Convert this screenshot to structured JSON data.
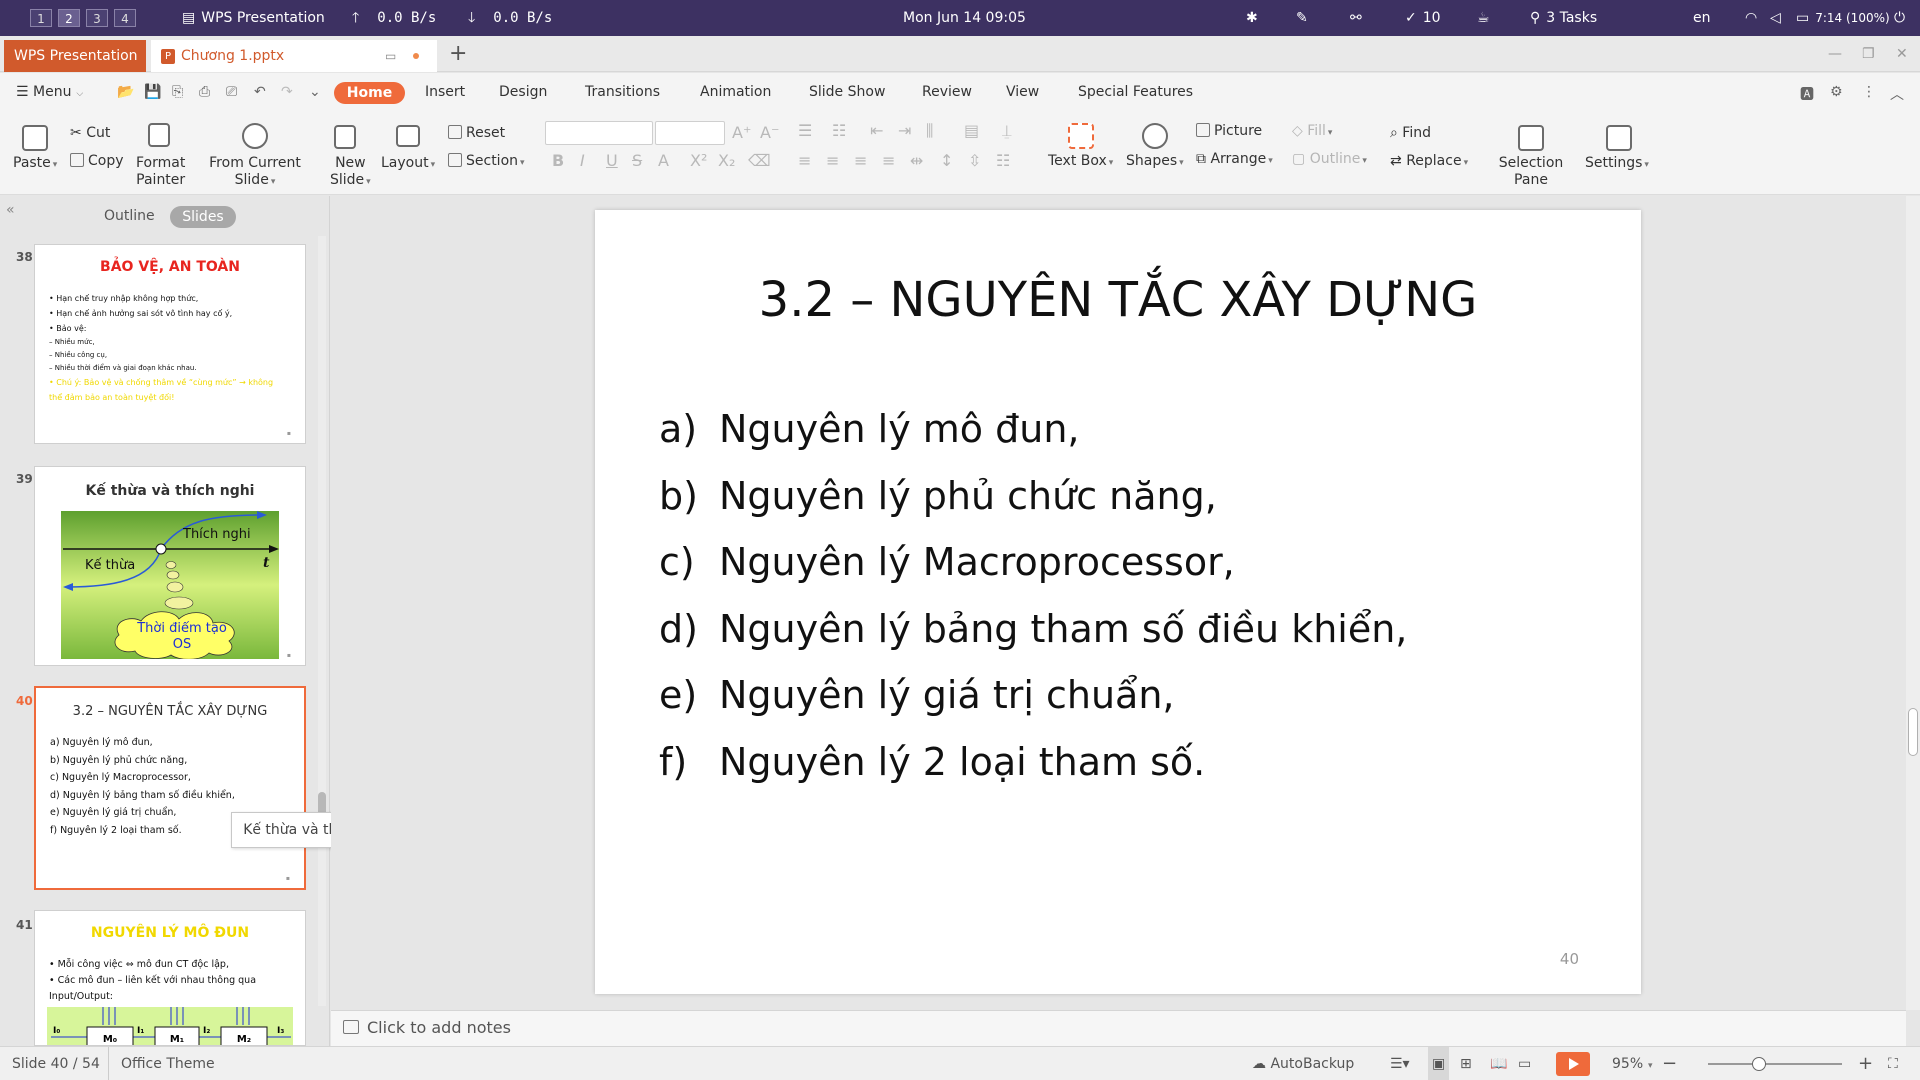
{
  "system_bar": {
    "workspaces": [
      "1",
      "2",
      "3",
      "4"
    ],
    "active_app": "WPS Presentation",
    "net_up": "0.0  B/s",
    "net_down": "0.0  B/s",
    "clock": "Mon Jun 14  09:05",
    "updates": "10",
    "tasks": "3 Tasks",
    "language": "en",
    "battery": "7:14 (100%)"
  },
  "tabs": {
    "app": "WPS Presentation",
    "doc": "Chương 1.pptx",
    "add_icon": "plus-icon"
  },
  "menu": {
    "menu_label": "Menu",
    "tabs": [
      "Home",
      "Insert",
      "Design",
      "Transitions",
      "Animation",
      "Slide Show",
      "Review",
      "View",
      "Special Features"
    ]
  },
  "ribbon": {
    "paste": "Paste",
    "cut": "Cut",
    "copy": "Copy",
    "format_painter_1": "Format",
    "format_painter_2": "Painter",
    "from_current_1": "From Current",
    "from_current_2": "Slide",
    "new_slide_1": "New",
    "new_slide_2": "Slide",
    "layout": "Layout",
    "reset": "Reset",
    "section": "Section",
    "text_box": "Text Box",
    "shapes": "Shapes",
    "picture": "Picture",
    "arrange": "Arrange",
    "fill": "Fill",
    "outline": "Outline",
    "find": "Find",
    "replace": "Replace",
    "selection_pane_1": "Selection",
    "selection_pane_2": "Pane",
    "settings": "Settings"
  },
  "left_panel": {
    "tab_outline": "Outline",
    "tab_slides": "Slides",
    "thumbnails": [
      {
        "number": "38",
        "title": "BẢO VỆ, AN TOÀN",
        "title_color": "#e8251f",
        "lines": [
          "•  Hạn chế truy nhập không hợp thức,",
          "•  Hạn chế ảnh hưởng sai sót vô tình hay cố ý,",
          "•  Bảo vệ:",
          "     –  Nhiều mức,",
          "     –  Nhiều công cụ,",
          "     –  Nhiều thời điểm và giai đoạn khác nhau.",
          "•  Chú ý: Bảo vệ và chống thâm về “cùng mức” → không",
          "    thể đảm bảo an toàn tuyệt đối!"
        ]
      },
      {
        "number": "39",
        "title": "Kế thừa và thích nghi",
        "title_color": "#111111",
        "diagram": {
          "label_right": "Thích nghi",
          "label_left": "Kế thừa",
          "axis": "t",
          "cloud": "Thời điểm tạo OS"
        }
      },
      {
        "number": "40",
        "title": "3.2 – NGUYÊN TẮC XÂY DỰNG",
        "title_color": "#111111",
        "lines": [
          "a)  Nguyên lý mô đun,",
          "b)  Nguyên lý phủ chức năng,",
          "c)  Nguyên lý Macroprocessor,",
          "d)  Nguyên lý bảng tham số điều khiển,",
          "e)  Nguyên lý giá trị chuẩn,",
          "f)   Nguyên lý 2 loại tham số."
        ]
      },
      {
        "number": "41",
        "title": "NGUYÊN LÝ MÔ ĐUN",
        "title_color": "#f1d800",
        "lines": [
          "•  Mỗi công việc ⇔ mô đun CT độc lập,",
          "•  Các mô đun – liên kết với nhau thông qua",
          "    Input/Output:"
        ],
        "modules": [
          "M₀",
          "M₁",
          "M₂"
        ],
        "io_labels": [
          "I₀",
          "I₁",
          "I₂",
          "I₃"
        ]
      }
    ],
    "tooltip": "Kế thừa và thích nghi"
  },
  "slide": {
    "title": "3.2 – NGUYÊN TẮC XÂY DỰNG",
    "items": [
      {
        "marker": "a)",
        "text": "Nguyên lý mô đun,"
      },
      {
        "marker": "b)",
        "text": "Nguyên lý phủ chức năng,"
      },
      {
        "marker": "c)",
        "text": "Nguyên lý Macroprocessor,"
      },
      {
        "marker": "d)",
        "text": "Nguyên lý bảng tham số điều khiển,"
      },
      {
        "marker": "e)",
        "text": "Nguyên lý giá trị chuẩn,"
      },
      {
        "marker": "f)",
        "text": "Nguyên lý 2 loại tham số."
      }
    ],
    "page_number": "40"
  },
  "notes": {
    "placeholder": "Click to add notes"
  },
  "status_bar": {
    "slide_count": "Slide 40 / 54",
    "theme": "Office Theme",
    "autobackup": "AutoBackup",
    "zoom": "95%"
  },
  "colors": {
    "accent": "#ef6a3b",
    "system_bar": "#3d3162",
    "app_tab": "#d15a2c"
  }
}
